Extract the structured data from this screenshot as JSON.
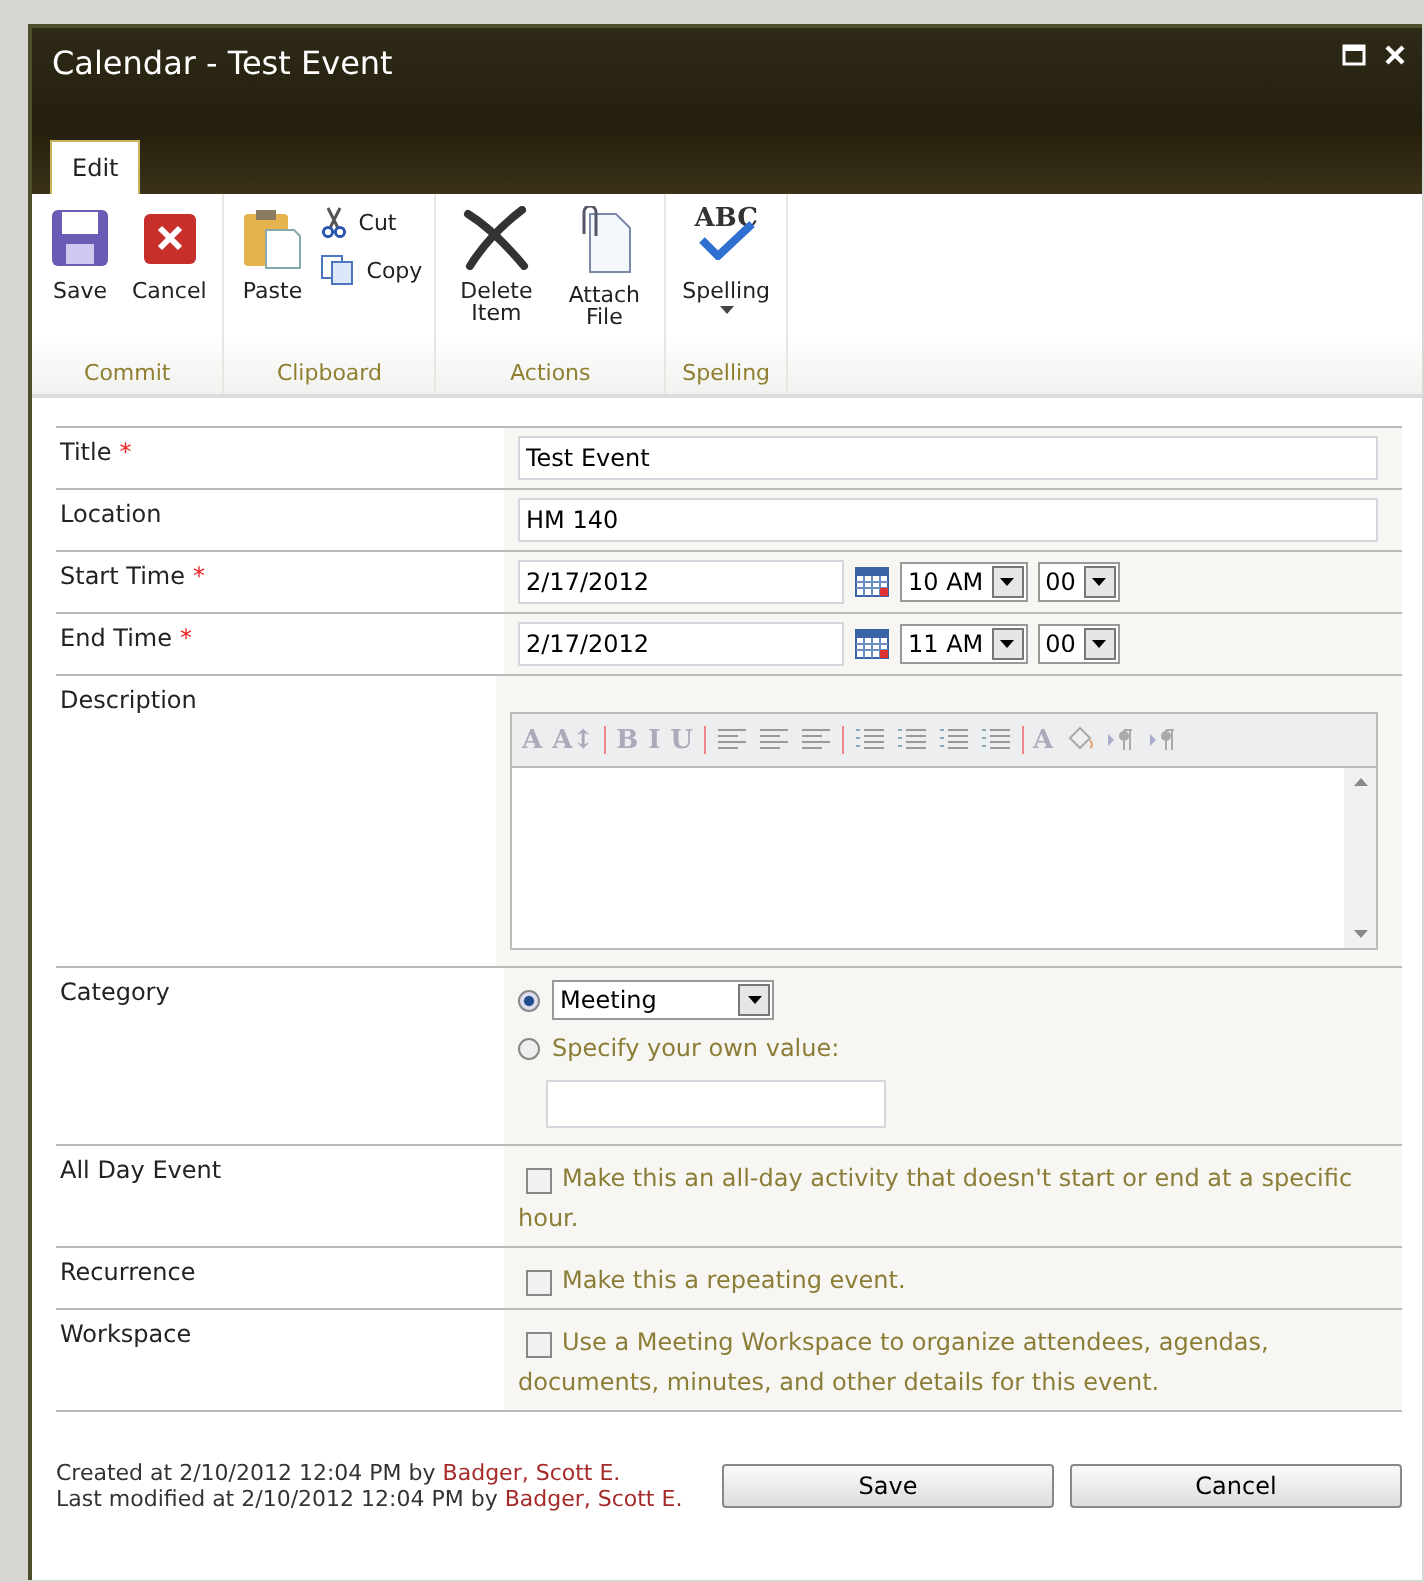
{
  "window": {
    "title": "Calendar - Test Event"
  },
  "tabs": [
    {
      "label": "Edit",
      "selected": true
    }
  ],
  "ribbon": [
    {
      "label": "Commit",
      "buttons": [
        {
          "label": "Save",
          "kind": "save"
        },
        {
          "label": "Cancel",
          "kind": "cancel"
        }
      ]
    },
    {
      "label": "Clipboard",
      "buttons": [
        {
          "label": "Paste",
          "kind": "paste"
        }
      ],
      "small_buttons": [
        {
          "label": "Cut",
          "kind": "cut"
        },
        {
          "label": "Copy",
          "kind": "copy"
        }
      ]
    },
    {
      "label": "Actions",
      "buttons": [
        {
          "label": "Delete Item",
          "kind": "delete"
        },
        {
          "label": "Attach File",
          "kind": "attach"
        }
      ]
    },
    {
      "label": "Spelling",
      "buttons": [
        {
          "label": "Spelling",
          "kind": "spelling",
          "icon_text": "ABC",
          "dropdown": true
        }
      ]
    }
  ],
  "fields": [
    {
      "label": "Title",
      "required": true,
      "kind": "text",
      "value": "Test Event"
    },
    {
      "label": "Location",
      "required": false,
      "kind": "text",
      "value": "HM 140"
    },
    {
      "label": "Start Time",
      "required": true,
      "kind": "datetime",
      "date": "2/17/2012",
      "hour": "10 AM",
      "minute": "00"
    },
    {
      "label": "End Time",
      "required": true,
      "kind": "datetime",
      "date": "2/17/2012",
      "hour": "11 AM",
      "minute": "00"
    },
    {
      "label": "Description",
      "required": false,
      "kind": "richtext",
      "toolbar": [
        {
          "kind": "text",
          "text": "A"
        },
        {
          "kind": "text",
          "text": "A↕"
        },
        {
          "kind": "sep"
        },
        {
          "kind": "text",
          "text": "B"
        },
        {
          "kind": "text",
          "text": "I"
        },
        {
          "kind": "text",
          "text": "U"
        },
        {
          "kind": "sep"
        },
        {
          "kind": "align"
        },
        {
          "kind": "align"
        },
        {
          "kind": "align"
        },
        {
          "kind": "sep"
        },
        {
          "kind": "list"
        },
        {
          "kind": "list"
        },
        {
          "kind": "list"
        },
        {
          "kind": "list"
        },
        {
          "kind": "sep"
        },
        {
          "kind": "text",
          "text": "A"
        },
        {
          "kind": "fill"
        },
        {
          "kind": "para"
        },
        {
          "kind": "para"
        }
      ]
    },
    {
      "label": "Category",
      "required": false,
      "kind": "choice",
      "options": [
        {
          "kind": "select",
          "value": "Meeting",
          "selected": true
        },
        {
          "kind": "custom",
          "label": "Specify your own value:",
          "selected": false
        }
      ]
    },
    {
      "label": "All Day Event",
      "required": false,
      "kind": "checkbox",
      "checked": false,
      "text": "Make this an all-day activity that doesn't start or end at a specific hour."
    },
    {
      "label": "Recurrence",
      "required": false,
      "kind": "checkbox",
      "checked": false,
      "text": "Make this a repeating event."
    },
    {
      "label": "Workspace",
      "required": false,
      "kind": "checkbox",
      "checked": false,
      "text": "Use a Meeting Workspace to organize attendees, agendas, documents, minutes, and other details for this event."
    }
  ],
  "required_mark": "*",
  "footer": {
    "lines": [
      {
        "text": "Created at 2/10/2012 12:04 PM by",
        "user": "Badger, Scott E."
      },
      {
        "text": "Last modified at 2/10/2012 12:04 PM by",
        "user": "Badger, Scott E."
      }
    ],
    "buttons": [
      "Save",
      "Cancel"
    ]
  }
}
